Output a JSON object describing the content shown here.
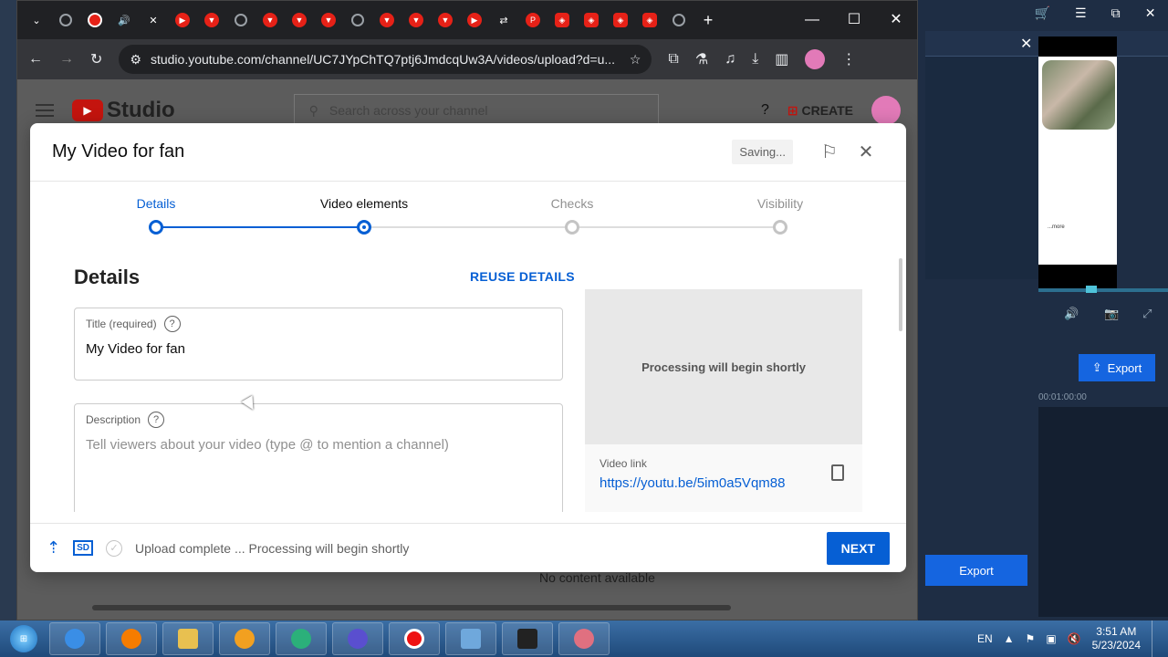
{
  "browser": {
    "url": "studio.youtube.com/channel/UC7JYpChTQ7ptj6JmdcqUw3A/videos/upload?d=u...",
    "tabs": [
      "globe",
      "record",
      "audio",
      "close",
      "yt",
      "yt",
      "globe",
      "yt",
      "yt",
      "yt",
      "globe",
      "yt",
      "yt",
      "yt",
      "yt",
      "share",
      "pinterest",
      "app",
      "app",
      "app",
      "app",
      "globe",
      "plus"
    ]
  },
  "studio": {
    "logo_text": "Studio",
    "search_placeholder": "Search across your channel",
    "create_label": "CREATE",
    "no_content": "No content available"
  },
  "modal": {
    "title": "My Video for fan",
    "saving": "Saving...",
    "steps": [
      "Details",
      "Video elements",
      "Checks",
      "Visibility"
    ],
    "section_title": "Details",
    "reuse_label": "REUSE DETAILS",
    "title_field": {
      "label": "Title (required)",
      "value": "My Video for fan"
    },
    "description_field": {
      "label": "Description",
      "placeholder": "Tell viewers about your video (type @ to mention a channel)"
    },
    "processing": "Processing will begin shortly",
    "video_link_label": "Video link",
    "video_link": "https://youtu.be/5im0a5Vqm88",
    "footer_status": "Upload complete ... Processing will begin shortly",
    "sd_badge": "SD",
    "next_label": "NEXT"
  },
  "bg_app": {
    "export_label": "Export",
    "export2_label": "Export",
    "timecode": "00:01:00:00",
    "more": "...more"
  },
  "taskbar": {
    "lang": "EN",
    "time": "3:51 AM",
    "date": "5/23/2024"
  }
}
